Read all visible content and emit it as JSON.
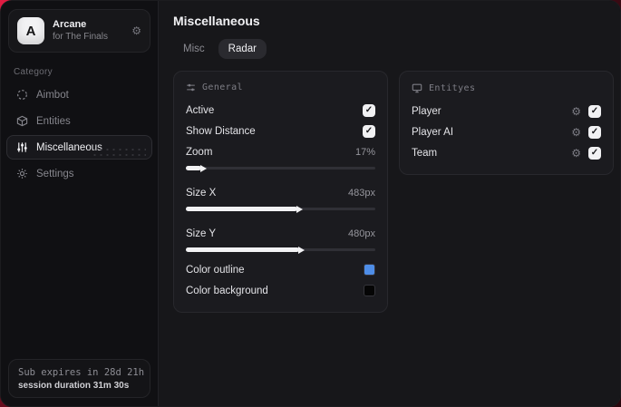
{
  "icons": {
    "check": "✓",
    "gear": "⚙"
  },
  "colors": {
    "background_red": "#c51734",
    "outline_blue": "#4e8de7",
    "background_black": "#050505"
  },
  "sidebar": {
    "brand": {
      "logo_letter": "A",
      "title": "Arcane",
      "subtitle": "for The Finals"
    },
    "category_label": "Category",
    "items": [
      {
        "label": "Aimbot",
        "icon": "crosshair-icon",
        "selected": false
      },
      {
        "label": "Entities",
        "icon": "box-icon",
        "selected": false
      },
      {
        "label": "Miscellaneous",
        "icon": "sliders-icon",
        "selected": true
      },
      {
        "label": "Settings",
        "icon": "gear-icon",
        "selected": false
      }
    ],
    "footer": {
      "line1": "Sub expires in 28d 21h",
      "line2": "session duration 31m 30s"
    }
  },
  "main": {
    "title": "Miscellaneous",
    "tabs": [
      {
        "label": "Misc",
        "active": false
      },
      {
        "label": "Radar",
        "active": true
      }
    ],
    "general": {
      "header": "General",
      "active": {
        "label": "Active",
        "checked": true
      },
      "show_distance": {
        "label": "Show Distance",
        "checked": true
      },
      "zoom": {
        "label": "Zoom",
        "value": "17%",
        "fill_percent": 8
      },
      "size_x": {
        "label": "Size X",
        "value": "483px",
        "fill_percent": 59
      },
      "size_y": {
        "label": "Size Y",
        "value": "480px",
        "fill_percent": 60
      },
      "color_outline": {
        "label": "Color outline",
        "color": "#4e8de7"
      },
      "color_background": {
        "label": "Color background",
        "color": "#050505"
      }
    },
    "entities": {
      "header": "Entityes",
      "rows": [
        {
          "label": "Player",
          "checked": true
        },
        {
          "label": "Player AI",
          "checked": true
        },
        {
          "label": "Team",
          "checked": true
        }
      ]
    }
  }
}
